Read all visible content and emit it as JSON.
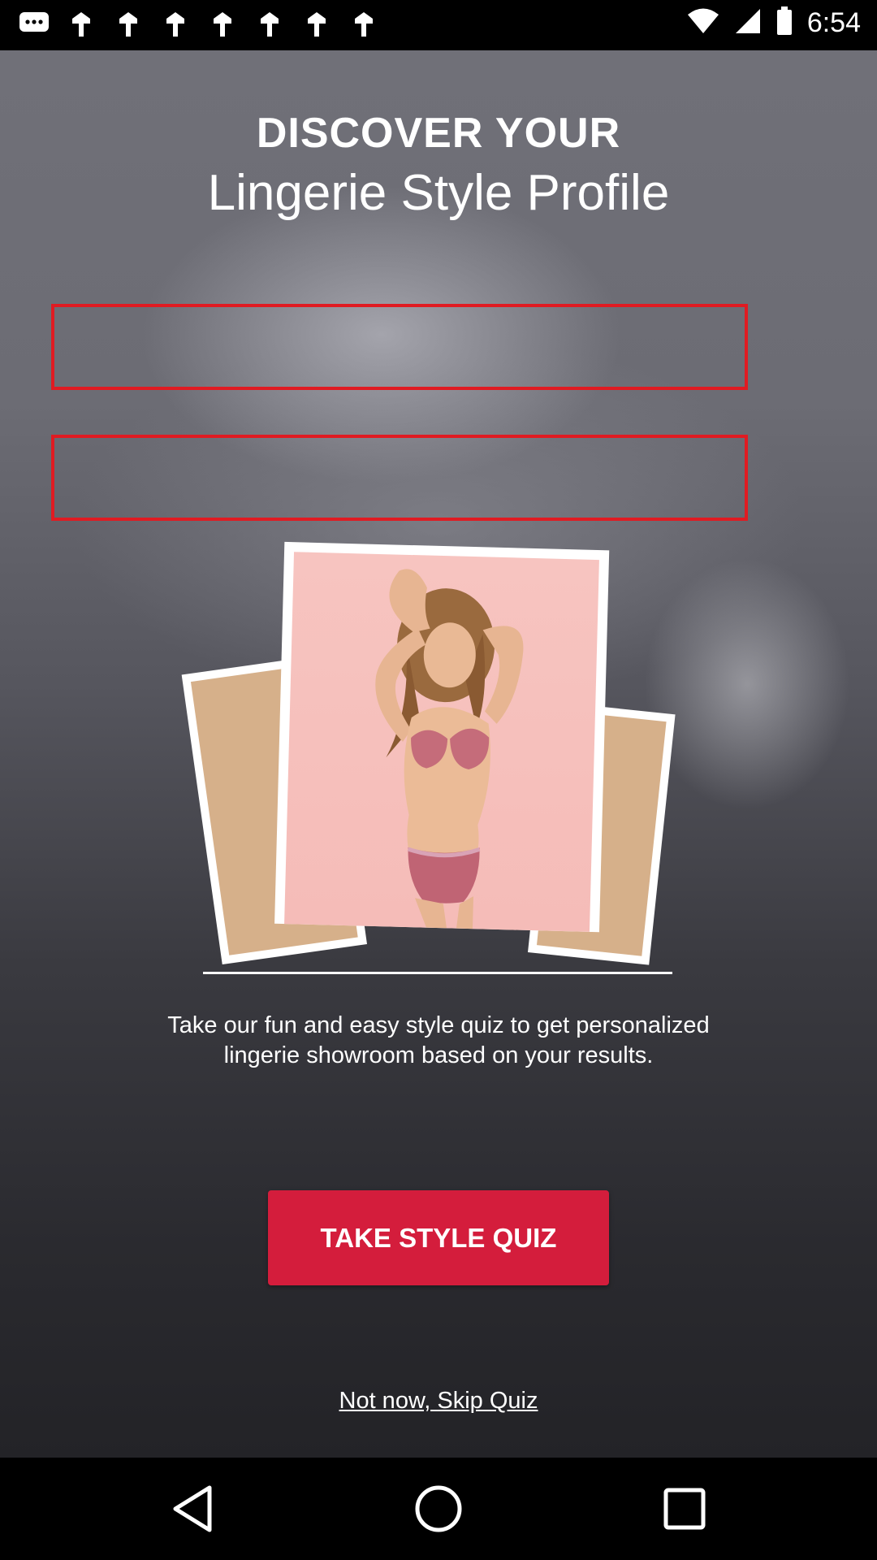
{
  "status_bar": {
    "time": "6:54",
    "notification_icons": [
      "chat-bubble-icon",
      "app-icon",
      "app-icon",
      "app-icon",
      "app-icon",
      "app-icon",
      "app-icon",
      "app-icon"
    ],
    "right_icons": [
      "wifi-icon",
      "signal-icon",
      "battery-icon"
    ]
  },
  "header": {
    "title_top": "DISCOVER YOUR",
    "title_sub": "Lingerie Style Profile"
  },
  "form": {
    "field_1_value": "",
    "field_2_value": ""
  },
  "main": {
    "description": "Take our fun and easy style quiz to get personalized lingerie showroom based on your results.",
    "cta_label": "TAKE STYLE QUIZ",
    "skip_label": "Not now, Skip Quiz"
  },
  "colors": {
    "accent": "#d41d3c",
    "field_border": "#e01b22",
    "photo_background": "#f7c4c0",
    "card_back": "#d6b08a"
  },
  "nav_bar": {
    "icons": [
      "back-icon",
      "home-icon",
      "recent-apps-icon"
    ]
  }
}
